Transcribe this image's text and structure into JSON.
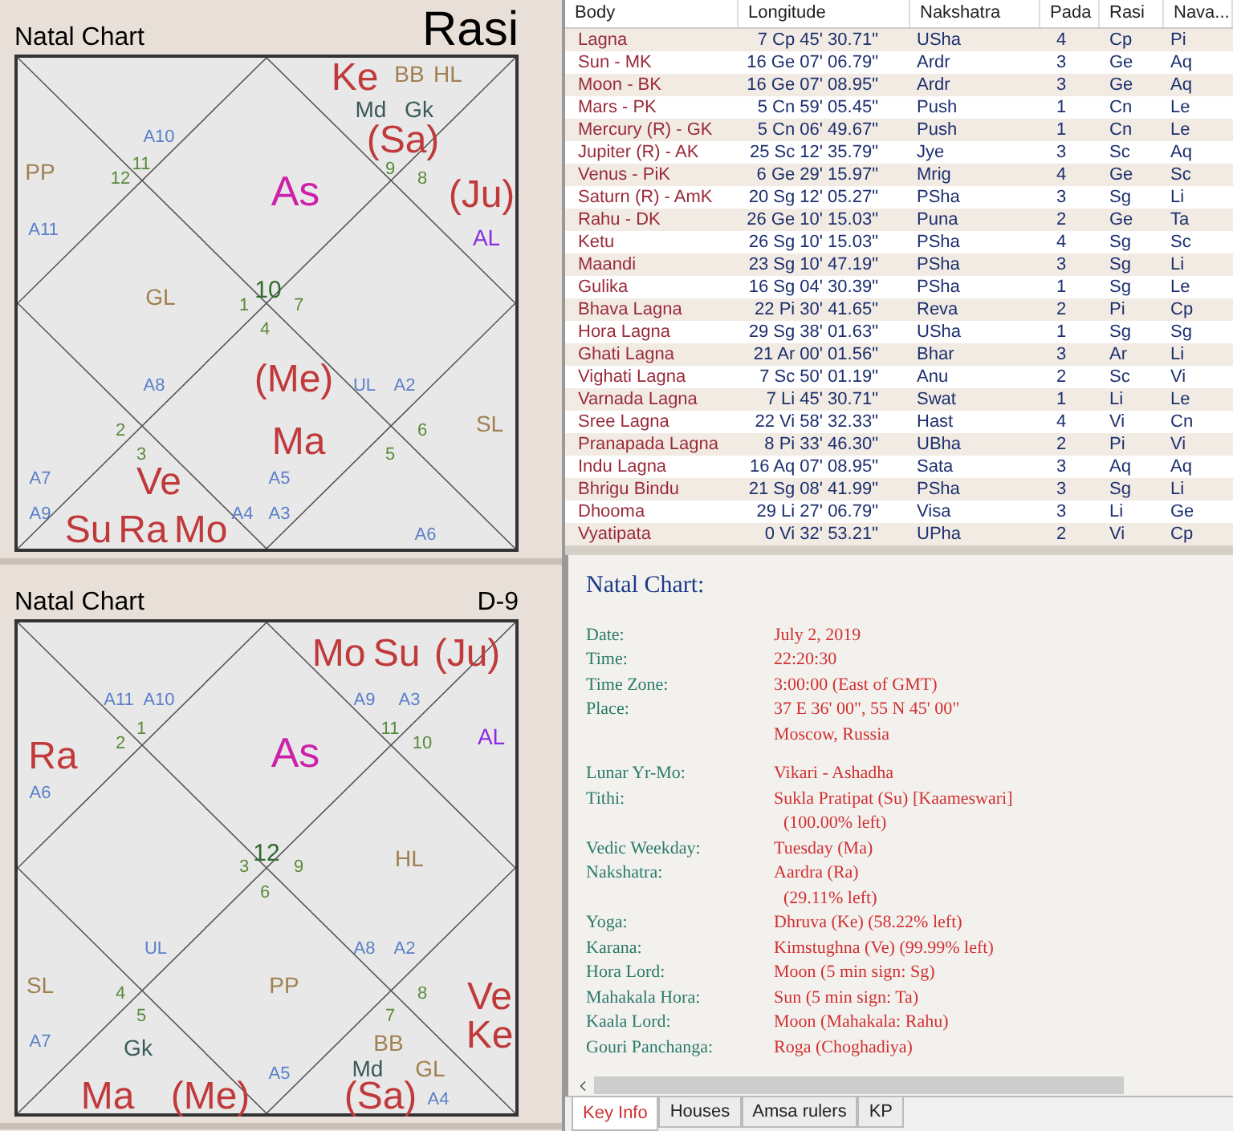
{
  "charts": [
    {
      "kind": "rasi",
      "title": "Natal Chart",
      "subtitle": "Rasi",
      "labels": [
        {
          "text": "Ke",
          "kind": "planet"
        },
        {
          "text": "BB",
          "kind": "special"
        },
        {
          "text": "HL",
          "kind": "special"
        },
        {
          "text": "Md",
          "kind": "upagraha"
        },
        {
          "text": "Gk",
          "kind": "upagraha"
        },
        {
          "text": "A10",
          "kind": "arudha"
        },
        {
          "text": "(Sa)",
          "kind": "planet"
        },
        {
          "text": "PP",
          "kind": "special"
        },
        {
          "text": "12",
          "kind": "house"
        },
        {
          "text": "11",
          "kind": "house"
        },
        {
          "text": "As",
          "kind": "ascendant"
        },
        {
          "text": "9",
          "kind": "house"
        },
        {
          "text": "8",
          "kind": "house"
        },
        {
          "text": "(Ju)",
          "kind": "planet"
        },
        {
          "text": "A11",
          "kind": "arudha"
        },
        {
          "text": "AL",
          "kind": "arudha_lagna"
        },
        {
          "text": "GL",
          "kind": "special"
        },
        {
          "text": "1",
          "kind": "house"
        },
        {
          "text": "10",
          "kind": "house_lagna"
        },
        {
          "text": "7",
          "kind": "house"
        },
        {
          "text": "4",
          "kind": "house"
        },
        {
          "text": "A8",
          "kind": "arudha"
        },
        {
          "text": "(Me)",
          "kind": "planet"
        },
        {
          "text": "UL",
          "kind": "arudha"
        },
        {
          "text": "A2",
          "kind": "arudha"
        },
        {
          "text": "2",
          "kind": "house"
        },
        {
          "text": "3",
          "kind": "house"
        },
        {
          "text": "Ma",
          "kind": "planet"
        },
        {
          "text": "5",
          "kind": "house"
        },
        {
          "text": "6",
          "kind": "house"
        },
        {
          "text": "SL",
          "kind": "special"
        },
        {
          "text": "A7",
          "kind": "arudha"
        },
        {
          "text": "Ve",
          "kind": "planet"
        },
        {
          "text": "A5",
          "kind": "arudha"
        },
        {
          "text": "A9",
          "kind": "arudha"
        },
        {
          "text": "Su",
          "kind": "planet"
        },
        {
          "text": "Ra",
          "kind": "planet"
        },
        {
          "text": "Mo",
          "kind": "planet"
        },
        {
          "text": "A4",
          "kind": "arudha"
        },
        {
          "text": "A3",
          "kind": "arudha"
        },
        {
          "text": "A6",
          "kind": "arudha"
        }
      ]
    },
    {
      "kind": "navamsa",
      "title": "Natal Chart",
      "subtitle": "D-9",
      "labels": [
        {
          "text": "Mo",
          "kind": "planet"
        },
        {
          "text": "Su",
          "kind": "planet"
        },
        {
          "text": "(Ju)",
          "kind": "planet"
        },
        {
          "text": "A11",
          "kind": "arudha"
        },
        {
          "text": "A10",
          "kind": "arudha"
        },
        {
          "text": "A9",
          "kind": "arudha"
        },
        {
          "text": "A3",
          "kind": "arudha"
        },
        {
          "text": "Ra",
          "kind": "planet"
        },
        {
          "text": "2",
          "kind": "house"
        },
        {
          "text": "1",
          "kind": "house"
        },
        {
          "text": "As",
          "kind": "ascendant"
        },
        {
          "text": "11",
          "kind": "house"
        },
        {
          "text": "10",
          "kind": "house"
        },
        {
          "text": "AL",
          "kind": "arudha_lagna"
        },
        {
          "text": "A6",
          "kind": "arudha"
        },
        {
          "text": "3",
          "kind": "house"
        },
        {
          "text": "12",
          "kind": "house_lagna"
        },
        {
          "text": "9",
          "kind": "house"
        },
        {
          "text": "HL",
          "kind": "special"
        },
        {
          "text": "6",
          "kind": "house"
        },
        {
          "text": "UL",
          "kind": "arudha"
        },
        {
          "text": "A8",
          "kind": "arudha"
        },
        {
          "text": "A2",
          "kind": "arudha"
        },
        {
          "text": "SL",
          "kind": "special"
        },
        {
          "text": "4",
          "kind": "house"
        },
        {
          "text": "5",
          "kind": "house"
        },
        {
          "text": "PP",
          "kind": "special"
        },
        {
          "text": "7",
          "kind": "house"
        },
        {
          "text": "8",
          "kind": "house"
        },
        {
          "text": "Ve",
          "kind": "planet"
        },
        {
          "text": "A7",
          "kind": "arudha"
        },
        {
          "text": "Gk",
          "kind": "upagraha"
        },
        {
          "text": "BB",
          "kind": "special"
        },
        {
          "text": "Ke",
          "kind": "planet"
        },
        {
          "text": "Ma",
          "kind": "planet"
        },
        {
          "text": "(Me)",
          "kind": "planet"
        },
        {
          "text": "A5",
          "kind": "arudha"
        },
        {
          "text": "Md",
          "kind": "upagraha"
        },
        {
          "text": "(Sa)",
          "kind": "planet"
        },
        {
          "text": "GL",
          "kind": "special"
        },
        {
          "text": "A4",
          "kind": "arudha"
        }
      ]
    }
  ],
  "table": {
    "columns": [
      "Body",
      "Longitude",
      "Nakshatra",
      "Pada",
      "Rasi",
      "Nava..."
    ],
    "rows": [
      [
        "Lagna",
        "7 Cp 45' 30.71\"",
        "USha",
        "4",
        "Cp",
        "Pi"
      ],
      [
        "Sun - MK",
        "16 Ge 07' 06.79\"",
        "Ardr",
        "3",
        "Ge",
        "Aq"
      ],
      [
        "Moon - BK",
        "16 Ge 07' 08.95\"",
        "Ardr",
        "3",
        "Ge",
        "Aq"
      ],
      [
        "Mars - PK",
        "5 Cn 59' 05.45\"",
        "Push",
        "1",
        "Cn",
        "Le"
      ],
      [
        "Mercury (R) - GK",
        "5 Cn 06' 49.67\"",
        "Push",
        "1",
        "Cn",
        "Le"
      ],
      [
        "Jupiter (R) - AK",
        "25 Sc 12' 35.79\"",
        "Jye",
        "3",
        "Sc",
        "Aq"
      ],
      [
        "Venus - PiK",
        "6 Ge 29' 15.97\"",
        "Mrig",
        "4",
        "Ge",
        "Sc"
      ],
      [
        "Saturn (R) - AmK",
        "20 Sg 12' 05.27\"",
        "PSha",
        "3",
        "Sg",
        "Li"
      ],
      [
        "Rahu - DK",
        "26 Ge 10' 15.03\"",
        "Puna",
        "2",
        "Ge",
        "Ta"
      ],
      [
        "Ketu",
        "26 Sg 10' 15.03\"",
        "PSha",
        "4",
        "Sg",
        "Sc"
      ],
      [
        "Maandi",
        "23 Sg 10' 47.19\"",
        "PSha",
        "3",
        "Sg",
        "Li"
      ],
      [
        "Gulika",
        "16 Sg 04' 30.39\"",
        "PSha",
        "1",
        "Sg",
        "Le"
      ],
      [
        "Bhava Lagna",
        "22 Pi 30' 41.65\"",
        "Reva",
        "2",
        "Pi",
        "Cp"
      ],
      [
        "Hora Lagna",
        "29 Sg 38' 01.63\"",
        "USha",
        "1",
        "Sg",
        "Sg"
      ],
      [
        "Ghati Lagna",
        "21 Ar 00' 01.56\"",
        "Bhar",
        "3",
        "Ar",
        "Li"
      ],
      [
        "Vighati Lagna",
        "7 Sc 50' 01.19\"",
        "Anu",
        "2",
        "Sc",
        "Vi"
      ],
      [
        "Varnada Lagna",
        "7 Li 45' 30.71\"",
        "Swat",
        "1",
        "Li",
        "Le"
      ],
      [
        "Sree Lagna",
        "22 Vi 58' 32.33\"",
        "Hast",
        "4",
        "Vi",
        "Cn"
      ],
      [
        "Pranapada Lagna",
        "8 Pi 33' 46.30\"",
        "UBha",
        "2",
        "Pi",
        "Vi"
      ],
      [
        "Indu Lagna",
        "16 Aq 07' 08.95\"",
        "Sata",
        "3",
        "Aq",
        "Aq"
      ],
      [
        "Bhrigu Bindu",
        "21 Sg 08' 41.99\"",
        "PSha",
        "3",
        "Sg",
        "Li"
      ],
      [
        "Dhooma",
        "29 Li 27' 06.79\"",
        "Visa",
        "3",
        "Li",
        "Ge"
      ],
      [
        "Vyatipata",
        "0 Vi 32' 53.21\"",
        "UPha",
        "2",
        "Vi",
        "Cp"
      ]
    ]
  },
  "key_info": {
    "title": "Natal Chart:",
    "groups": [
      [
        {
          "label": "Date:",
          "values": [
            "July 2, 2019"
          ]
        },
        {
          "label": "Time:",
          "values": [
            "22:20:30"
          ]
        },
        {
          "label": "Time Zone:",
          "values": [
            "3:00:00 (East of GMT)"
          ]
        },
        {
          "label": "Place:",
          "values": [
            "37 E 36' 00\", 55 N 45' 00\"",
            "Moscow, Russia"
          ]
        }
      ],
      [
        {
          "label": "Lunar Yr-Mo:",
          "values": [
            "Vikari - Ashadha"
          ]
        },
        {
          "label": "Tithi:",
          "values": [
            "Sukla Pratipat (Su) [Kaameswari]"
          ],
          "note": "(100.00% left)"
        },
        {
          "label": "Vedic Weekday:",
          "values": [
            "Tuesday (Ma)"
          ]
        },
        {
          "label": "Nakshatra:",
          "values": [
            "Aardra (Ra)"
          ],
          "note": "(29.11% left)"
        },
        {
          "label": "Yoga:",
          "values": [
            "Dhruva (Ke) (58.22% left)"
          ]
        },
        {
          "label": "Karana:",
          "values": [
            "Kimstughna (Ve) (99.99% left)"
          ]
        },
        {
          "label": "Hora Lord:",
          "values": [
            "Moon (5 min sign: Sg)"
          ]
        },
        {
          "label": "Mahakala Hora:",
          "values": [
            "Sun (5 min sign: Ta)"
          ]
        },
        {
          "label": "Kaala Lord:",
          "values": [
            "Moon (Mahakala: Rahu)"
          ]
        },
        {
          "label": "Gouri Panchanga:",
          "values": [
            "Roga (Choghadiya)"
          ]
        }
      ]
    ]
  },
  "tabs": [
    {
      "label": "Key Info",
      "selected": true
    },
    {
      "label": "Houses",
      "selected": false
    },
    {
      "label": "Amsa rulers",
      "selected": false
    },
    {
      "label": "KP",
      "selected": false
    }
  ]
}
